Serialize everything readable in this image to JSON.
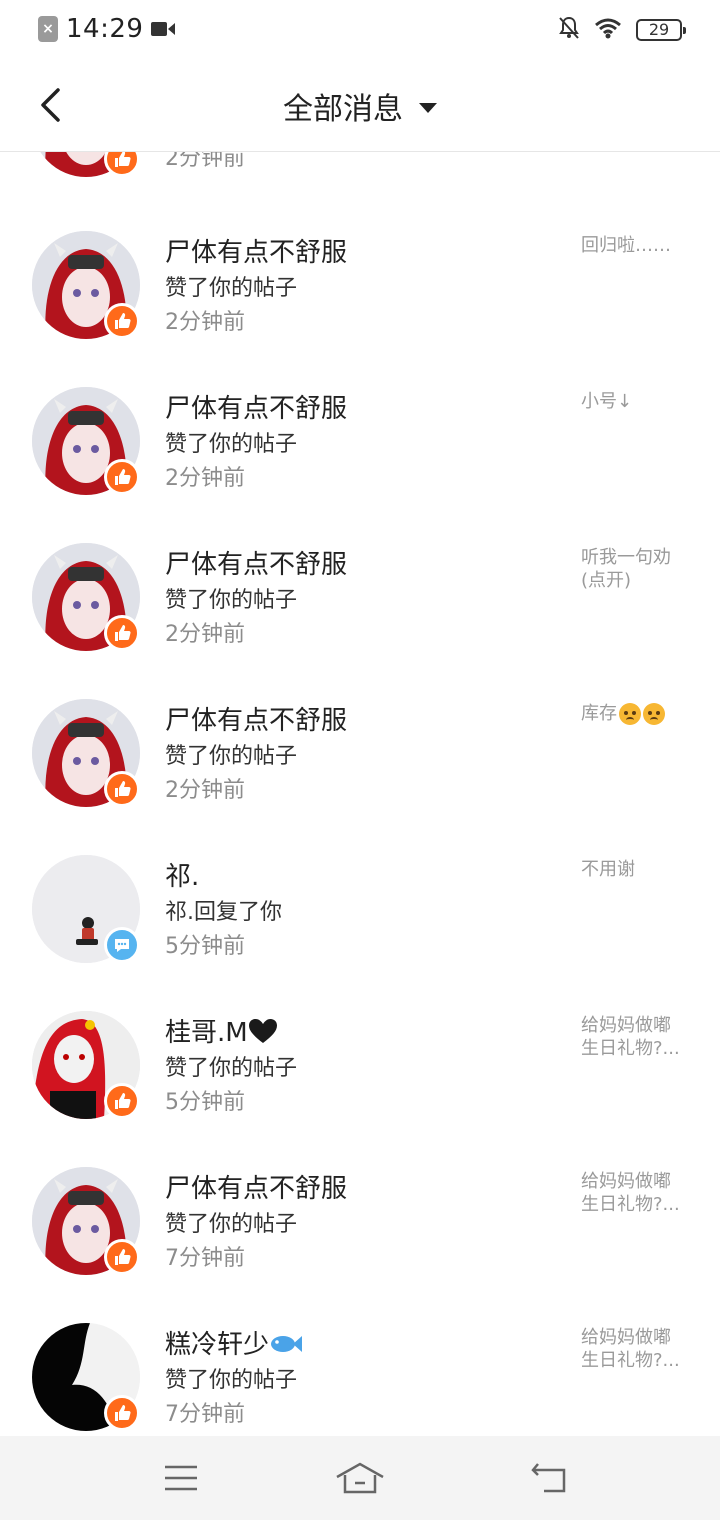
{
  "status_bar": {
    "time": "14:29",
    "battery": "29",
    "icons": [
      "sim-off-icon",
      "video-camera-icon",
      "bell-muted-icon",
      "wifi-icon",
      "battery-icon"
    ]
  },
  "header": {
    "title": "全部消息",
    "back_icon": "chevron-left-icon",
    "dropdown_icon": "caret-down-icon"
  },
  "messages": [
    {
      "name": "",
      "action": "",
      "time": "2分钟前",
      "preview": "",
      "type": "like",
      "avatar": "anime-red-hair"
    },
    {
      "name": "尸体有点不舒服",
      "action": "赞了你的帖子",
      "time": "2分钟前",
      "preview": "回归啦……",
      "type": "like",
      "avatar": "anime-red-hair"
    },
    {
      "name": "尸体有点不舒服",
      "action": "赞了你的帖子",
      "time": "2分钟前",
      "preview": "小号↓",
      "type": "like",
      "avatar": "anime-red-hair"
    },
    {
      "name": "尸体有点不舒服",
      "action": "赞了你的帖子",
      "time": "2分钟前",
      "preview": "听我一句劝(点开)",
      "type": "like",
      "avatar": "anime-red-hair"
    },
    {
      "name": "尸体有点不舒服",
      "action": "赞了你的帖子",
      "time": "2分钟前",
      "preview": "库存",
      "type": "like",
      "avatar": "anime-red-hair"
    },
    {
      "name": "祁.",
      "action": "祁.回复了你",
      "time": "5分钟前",
      "preview": "不用谢",
      "type": "reply",
      "avatar": "small-figure"
    },
    {
      "name": "桂哥.M",
      "action": "赞了你的帖子",
      "time": "5分钟前",
      "preview": "给妈妈做嘟生日礼物?...",
      "type": "like",
      "avatar": "white-mask"
    },
    {
      "name": "尸体有点不舒服",
      "action": "赞了你的帖子",
      "time": "7分钟前",
      "preview": "给妈妈做嘟生日礼物?...",
      "type": "like",
      "avatar": "anime-red-hair"
    },
    {
      "name": "糕冷轩少",
      "action": "赞了你的帖子",
      "time": "7分钟前",
      "preview": "给妈妈做嘟生日礼物?...",
      "type": "like",
      "avatar": "silhouette"
    }
  ],
  "nav_bar": {
    "buttons": [
      "menu-icon",
      "home-icon",
      "back-icon"
    ]
  },
  "colors": {
    "like_badge": "#ff6a1a",
    "reply_badge": "#56b4f0",
    "secondary_text": "#8c8c8c"
  }
}
